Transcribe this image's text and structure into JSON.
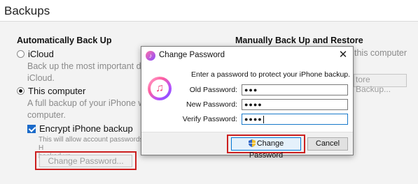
{
  "page": {
    "title": "Backups"
  },
  "auto_backup": {
    "heading": "Automatically Back Up",
    "icloud_label": "iCloud",
    "icloud_desc": "Back up the most important data\niCloud.",
    "this_computer_label": "This computer",
    "this_computer_desc": "A full backup of your iPhone will\ncomputer.",
    "encrypt_label": "Encrypt iPhone backup",
    "encrypt_desc": "This will allow account passwords, H\nbacked up.",
    "change_password_label": "Change Password..."
  },
  "manual_backup": {
    "heading": "Manually Back Up and Restore",
    "this_computer_fragment": "this computer",
    "restore_fragment": "tore Backup..."
  },
  "dialog": {
    "title": "Change Password",
    "close_glyph": "✕",
    "prompt": "Enter a password to protect your iPhone backup.",
    "old_label": "Old Password:",
    "old_value": "●●●",
    "new_label": "New Password:",
    "new_value": "●●●●",
    "verify_label": "Verify Password:",
    "verify_value": "●●●●",
    "change_button": "Change Password",
    "cancel_button": "Cancel"
  },
  "icons": {
    "app": "itunes-icon",
    "shield": "uac-shield-icon",
    "close": "close-icon"
  },
  "colors": {
    "highlight": "#cc1f1f",
    "accent": "#0078d7"
  }
}
